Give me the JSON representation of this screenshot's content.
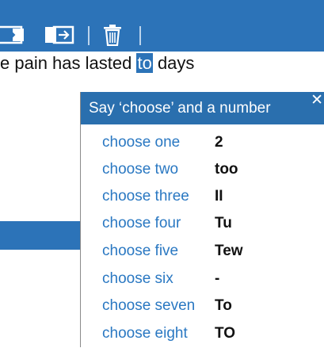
{
  "document": {
    "text_before": "e pain has lasted ",
    "selected_word": "to",
    "text_after": " days"
  },
  "toolbar": {
    "icons": [
      "insert-icon",
      "import-icon",
      "trash-icon"
    ]
  },
  "correction_panel": {
    "title": "Say ‘choose’ and a number",
    "close_label": "✕",
    "items": [
      {
        "command": "choose one",
        "word": "2"
      },
      {
        "command": "choose two",
        "word": "too"
      },
      {
        "command": "choose three",
        "word": "II"
      },
      {
        "command": "choose four",
        "word": "Tu"
      },
      {
        "command": "choose five",
        "word": "Tew"
      },
      {
        "command": "choose six",
        "word": "-"
      },
      {
        "command": "choose seven",
        "word": "To"
      },
      {
        "command": "choose eight",
        "word": "TO"
      }
    ]
  },
  "colors": {
    "accent": "#2c73b8",
    "link": "#2a78c2"
  }
}
